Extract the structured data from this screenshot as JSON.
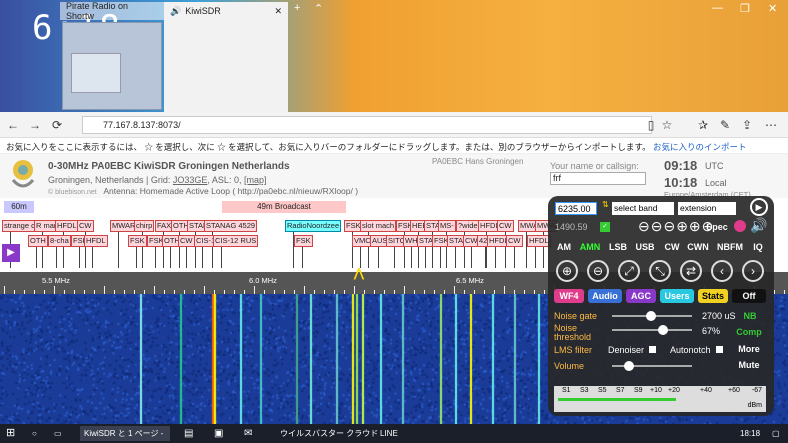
{
  "desktop": {
    "clock": "6:18"
  },
  "browser": {
    "tabs": [
      {
        "label": "Pirate Radio on Shortw"
      },
      {
        "label": "KiwiSDR"
      }
    ],
    "new_tab": "+",
    "url": "77.167.8.137:8073/",
    "fav_prompt": "お気に入りをここに表示するには、 ☆ を選択し、次に ☆ を選択して、お気に入りバーのフォルダーにドラッグします。または、別のブラウザーからインポートします。",
    "fav_link": "お気に入りのインポート"
  },
  "kiwi": {
    "title": "0-30MHz PA0EBC KiwiSDR Groningen Netherlands",
    "location_prefix": "Groningen, Netherlands | Grid: ",
    "grid": "JO33GE",
    "asl": ", ASL: 0, ",
    "map": "[map]",
    "owner": "PA0EBC Hans Groningen",
    "antenna": "Antenna: Homemade Active Loop ( http://pa0ebc.nl/nieuw/RXloop/ )",
    "credit": "© bluebison.net",
    "callsign_label": "Your name or callsign:",
    "callsign_value": "frf",
    "utc_time": "09:18",
    "utc_label": "UTC",
    "local_time": "10:18",
    "local_label": "Local",
    "timezone": "Europe/Amsterdam (CET)"
  },
  "bands": [
    {
      "label": "60m",
      "color": "#c8c8ff"
    },
    {
      "label": "49m Broadcast",
      "color": "#ffc8c8"
    }
  ],
  "stations": [
    "strange d",
    "R mar",
    "HFDL",
    "CW",
    "MWAR",
    "chirp",
    "FAX",
    "OTH",
    "STAN",
    "STANAG 4529",
    "RadioNoordzee",
    "FSK",
    "slot mach",
    "FSK",
    "HEB",
    "STAN",
    "MS-",
    "?wide",
    "HFDL",
    "CW",
    "MWA",
    "MWA",
    "OTH",
    "8-cha",
    "FSK",
    "HFDL",
    "FSK",
    "FSK",
    "OTH",
    "CW",
    "CIS-1",
    "CIS-12 RUS",
    "FSK",
    "VMC",
    "AUS",
    "SITC",
    "WH",
    "STA",
    "FSK",
    "STA",
    "CW",
    "428",
    "HFDL",
    "CW",
    "HFDL"
  ],
  "scale": [
    "5.5 MHz",
    "6.0 MHz",
    "6.5 MHz"
  ],
  "panel": {
    "frequency": "6235.00",
    "band_select": "select band",
    "ext_select": "extension",
    "freq2": "1490.59",
    "spec": "Spec",
    "modes": [
      "AM",
      "AMN",
      "LSB",
      "USB",
      "CW",
      "CWN",
      "NBFM",
      "IQ"
    ],
    "tabs": [
      "WF4",
      "Audio",
      "AGC",
      "Users",
      "Stats",
      "Off"
    ],
    "noise_gate_label": "Noise gate",
    "noise_gate_value": "2700 uS",
    "nb": "NB",
    "noise_threshold_label": "Noise threshold",
    "noise_threshold_value": "67%",
    "comp": "Comp",
    "lms_filter": "LMS filter",
    "denoiser": "Denoiser",
    "autonotch": "Autonotch",
    "more": "More",
    "volume": "Volume",
    "mute": "Mute",
    "smeter": [
      "S1",
      "S3",
      "S5",
      "S7",
      "S9",
      "+10",
      "+20",
      "+40",
      "+60"
    ],
    "smeter_value": "-67",
    "smeter_unit": "dBm"
  },
  "taskbar": {
    "app1": "KiwiSDR と 1 ページ - ...",
    "app2": "ウイルスバスター クラウド",
    "app3": "LINE",
    "time": "18:18"
  }
}
